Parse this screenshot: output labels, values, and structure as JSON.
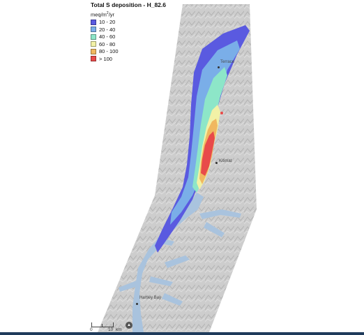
{
  "legend": {
    "title": "Total S deposition - H_82.6",
    "units_base": "meq/m",
    "units_sup": "2",
    "units_tail": "/yr",
    "classes": [
      {
        "label": "10 - 20",
        "color": "#5a5ae0"
      },
      {
        "label": "20 - 40",
        "color": "#7aaee8"
      },
      {
        "label": "40 - 60",
        "color": "#8de6c8"
      },
      {
        "label": "60 - 80",
        "color": "#f2f1a6"
      },
      {
        "label": "80 - 100",
        "color": "#f0b860"
      },
      {
        "label": "> 100",
        "color": "#e84a4a"
      }
    ]
  },
  "places": [
    {
      "name": "Terrace"
    },
    {
      "name": "Kitimat"
    },
    {
      "name": "Hartley Bay"
    }
  ],
  "scale": {
    "zero": "0",
    "end": "10",
    "unit": "km"
  },
  "colors": {
    "water": "#a9c3de",
    "terrain": "#cfcfcf",
    "frame": "#1f3b5b"
  }
}
